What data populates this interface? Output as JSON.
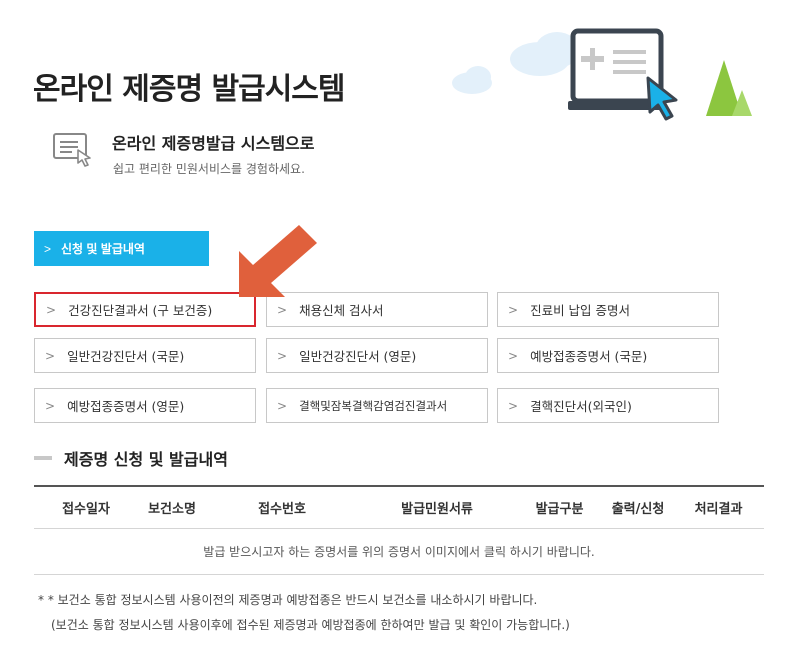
{
  "page": {
    "title": "온라인 제증명 발급시스템"
  },
  "intro": {
    "title": "온라인 제증명발급 시스템으로",
    "subtitle": "쉽고 편리한 민원서비스를 경험하세요."
  },
  "apply_button": {
    "label": "신청 및 발급내역"
  },
  "documents": [
    {
      "label": "건강진단결과서 (구 보건증)",
      "highlight": true
    },
    {
      "label": "채용신체 검사서"
    },
    {
      "label": "진료비 납입 증명서"
    },
    {
      "label": "일반건강진단서 (국문)"
    },
    {
      "label": "일반건강진단서 (영문)"
    },
    {
      "label": "예방접종증명서 (국문)"
    },
    {
      "label": "예방접종증명서 (영문)"
    },
    {
      "label": "결핵및잠복결핵감염검진결과서"
    },
    {
      "label": "결핵진단서(외국인)"
    }
  ],
  "history": {
    "title": "제증명 신청 및 발급내역",
    "columns": [
      "접수일자",
      "보건소명",
      "접수번호",
      "발급민원서류",
      "발급구분",
      "출력/신청",
      "처리결과"
    ],
    "empty_message": "발급 받으시고자 하는 증명서를 위의 증명서 이미지에서 클릭 하시기 바랍니다."
  },
  "notes": {
    "line1": "* * 보건소 통합 정보시스템 사용이전의 제증명과 예방접종은 반드시 보건소를 내소하시기 바랍니다.",
    "line2": "(보건소 통합 정보시스템 사용이후에 접수된 제증명과 예방접종에 한하여만 발급 및 확인이 가능합니다.)"
  },
  "colors": {
    "accent": "#1ab1e8",
    "highlight": "#d9262e",
    "arrow": "#e0603c",
    "tree": "#8cc63f"
  },
  "icons": {
    "chevron": "chevron-right-icon",
    "hero": "certificate-monitor-icon",
    "intro": "document-cursor-icon"
  }
}
